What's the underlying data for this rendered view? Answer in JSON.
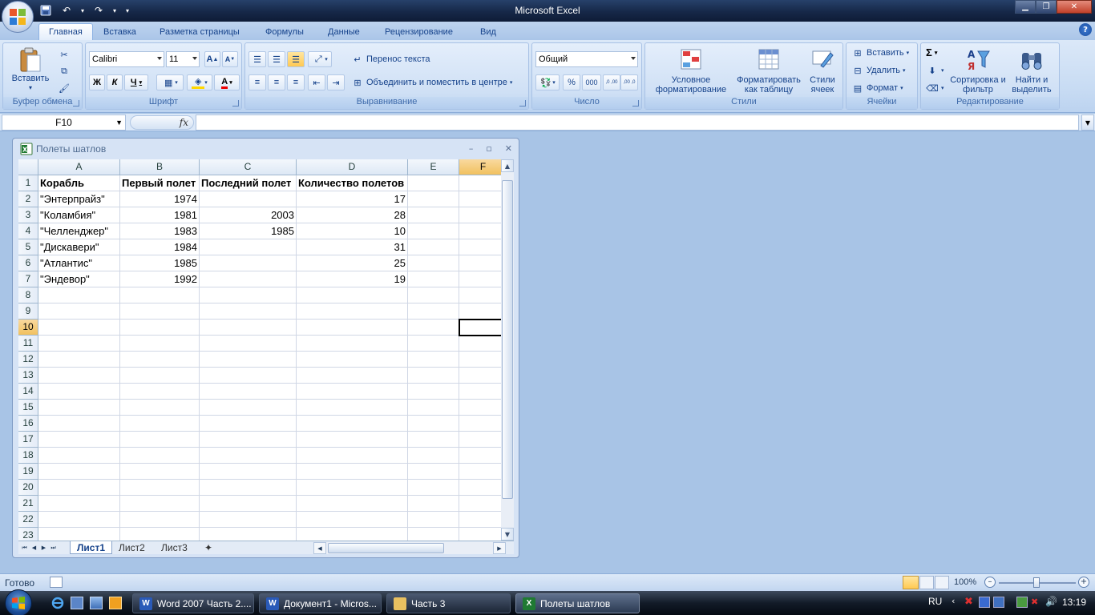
{
  "window": {
    "title": "Microsoft Excel"
  },
  "ribbon": {
    "tabs": [
      "Главная",
      "Вставка",
      "Разметка страницы",
      "Формулы",
      "Данные",
      "Рецензирование",
      "Вид"
    ],
    "clipboard": {
      "paste": "Вставить",
      "group_label": "Буфер обмена"
    },
    "font": {
      "family": "Calibri",
      "size": "11",
      "bold": "Ж",
      "italic": "К",
      "underline": "Ч",
      "grow": "A",
      "shrink": "A",
      "color_glyph": "A",
      "group_label": "Шрифт"
    },
    "alignment": {
      "wrap_text": "Перенос текста",
      "merge_center": "Объединить и поместить в центре",
      "group_label": "Выравнивание"
    },
    "number": {
      "format": "Общий",
      "percent": "%",
      "thousands": "000",
      "inc_decimal": ",0 ,00",
      "dec_decimal": ",00 ,0",
      "group_label": "Число"
    },
    "styles": {
      "conditional": "Условное форматирование",
      "format_table": "Форматировать как таблицу",
      "cell_styles": "Стили ячеек",
      "group_label": "Стили"
    },
    "cells": {
      "insert": "Вставить",
      "delete": "Удалить",
      "format": "Формат",
      "group_label": "Ячейки"
    },
    "editing": {
      "sum": "Σ",
      "sort_filter": "Сортировка и фильтр",
      "find_select": "Найти и выделить",
      "group_label": "Редактирование"
    }
  },
  "formula_bar": {
    "name_box": "F10",
    "fx": "fx",
    "value": ""
  },
  "workbook": {
    "title": "Полеты шатлов",
    "columns": [
      "A",
      "B",
      "C",
      "D",
      "E",
      "F"
    ],
    "selected_column": "F",
    "selected_row": "10",
    "rows": [
      "1",
      "2",
      "3",
      "4",
      "5",
      "6",
      "7",
      "8",
      "9",
      "10",
      "11",
      "12",
      "13",
      "14",
      "15",
      "16",
      "17",
      "18",
      "19",
      "20",
      "21",
      "22",
      "23"
    ],
    "table": {
      "header": [
        "Корабль",
        "Первый полет",
        "Последний полет",
        "Количество полетов"
      ],
      "data": [
        [
          "\"Энтерпрайз\"",
          "1974",
          "",
          "17"
        ],
        [
          "\"Коламбия\"",
          "1981",
          "2003",
          "28"
        ],
        [
          "\"Челленджер\"",
          "1983",
          "1985",
          "10"
        ],
        [
          "\"Дискавери\"",
          "1984",
          "",
          "31"
        ],
        [
          "\"Атлантис\"",
          "1985",
          "",
          "25"
        ],
        [
          "\"Эндевор\"",
          "1992",
          "",
          "19"
        ]
      ]
    },
    "sheets": [
      "Лист1",
      "Лист2",
      "Лист3"
    ],
    "active_sheet": "Лист1"
  },
  "status_bar": {
    "status": "Готово",
    "zoom": "100%"
  },
  "taskbar": {
    "tasks": [
      "Word 2007 Часть 2....",
      "Документ1 - Micros...",
      "Часть 3",
      "Полеты шатлов"
    ],
    "active_task": "Полеты шатлов",
    "language": "RU",
    "clock": "13:19"
  }
}
